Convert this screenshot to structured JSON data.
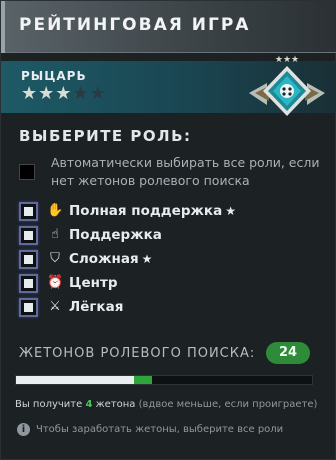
{
  "header": {
    "title": "РЕЙТИНГОВАЯ ИГРА"
  },
  "rank": {
    "name": "РЫЦАРЬ",
    "stars_filled": 3,
    "stars_total": 5,
    "badge_stars": "★★★"
  },
  "roles": {
    "heading": "ВЫБЕРИТЕ РОЛЬ:",
    "auto_text": "Автоматически выбирать все роли, если нет жетонов ролевого поиска",
    "items": [
      {
        "label": "Полная поддержка",
        "icon": "hands-icon",
        "starred": true
      },
      {
        "label": "Поддержка",
        "icon": "hand-icon",
        "starred": false
      },
      {
        "label": "Сложная",
        "icon": "shield-icon",
        "starred": true
      },
      {
        "label": "Центр",
        "icon": "clock-icon",
        "starred": false
      },
      {
        "label": "Лёгкая",
        "icon": "sword-icon",
        "starred": false
      }
    ]
  },
  "tokens": {
    "label": "ЖЕТОНОВ РОЛЕВОГО ПОИСКА:",
    "count": "24",
    "progress": 0.4,
    "gain": 0.06,
    "gain_prefix": "Вы получите",
    "gain_number": "4",
    "gain_suffix": "жетона",
    "gain_note": "(вдвое меньше, если проиграете)",
    "info_text": "Чтобы заработать жетоны, выберите все роли"
  },
  "colors": {
    "accent_green": "#2e8b3a",
    "rank_teal": "#1d5a66",
    "checkbox_border": "#5f6a9e"
  }
}
